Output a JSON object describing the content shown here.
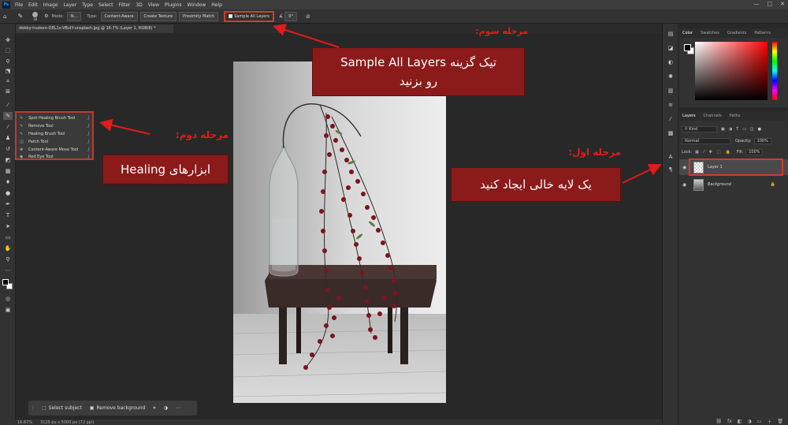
{
  "app": {
    "logo": "Ps",
    "menus": [
      "File",
      "Edit",
      "Image",
      "Layer",
      "Type",
      "Select",
      "Filter",
      "3D",
      "View",
      "Plugins",
      "Window",
      "Help"
    ],
    "window_controls": [
      "—",
      "□",
      "✕"
    ]
  },
  "options_bar": {
    "brush_size": "30",
    "mode_label": "Mode:",
    "mode_value": "N...",
    "type_label": "Type:",
    "type_options": [
      "Content-Aware",
      "Create Texture",
      "Proximity Match"
    ],
    "sample_all_layers": "Sample All Layers",
    "angle": "0°"
  },
  "document": {
    "tab_title": "debby-hudson-OEL1v-VBuIY-unsplash.jpg @ 16.7% (Layer 1, RGB/8) *"
  },
  "status_bar": {
    "zoom": "16.67%",
    "doc_size": "3125 px x 5000 px (72 ppi)"
  },
  "taskbar": {
    "select_subject": "Select subject",
    "remove_background": "Remove background"
  },
  "healing_flyout": {
    "items": [
      {
        "label": "Spot Healing Brush Tool",
        "key": "J"
      },
      {
        "label": "Remove Tool",
        "key": "J"
      },
      {
        "label": "Healing Brush Tool",
        "key": "J"
      },
      {
        "label": "Patch Tool",
        "key": "J"
      },
      {
        "label": "Content-Aware Move Tool",
        "key": "J"
      },
      {
        "label": "Red Eye Tool",
        "key": "J"
      }
    ]
  },
  "color_panel": {
    "tabs": [
      "Color",
      "Swatches",
      "Gradients",
      "Patterns"
    ]
  },
  "layers_panel": {
    "tabs": [
      "Layers",
      "Channels",
      "Paths"
    ],
    "filter_kind": "Kind",
    "blend_mode": "Normal",
    "opacity_label": "Opacity:",
    "opacity_value": "100%",
    "lock_label": "Lock:",
    "fill_label": "Fill:",
    "fill_value": "100%",
    "layers": [
      {
        "name": "Layer 1",
        "selected": true
      },
      {
        "name": "Background",
        "selected": false,
        "locked": true
      }
    ],
    "bottom_icons": [
      "⛓",
      "fx",
      "◧",
      "◑",
      "▭",
      "＋",
      "🗑"
    ]
  },
  "annotations": {
    "step3_title": "مرحله سوم:",
    "step3_line1": "تیک گزینه Sample All Layers",
    "step3_line2": "رو بزنید",
    "step2_title": "مرحله دوم:",
    "step2_text": "ابزارهای Healing",
    "step1_title": "مرحله اول:",
    "step1_text": "یک لایه خالی ایجاد کنید"
  },
  "colors": {
    "annotation_bg": "#8b1a1a",
    "annotation_red": "#e21b1b",
    "highlight_border": "#d23a2f"
  }
}
